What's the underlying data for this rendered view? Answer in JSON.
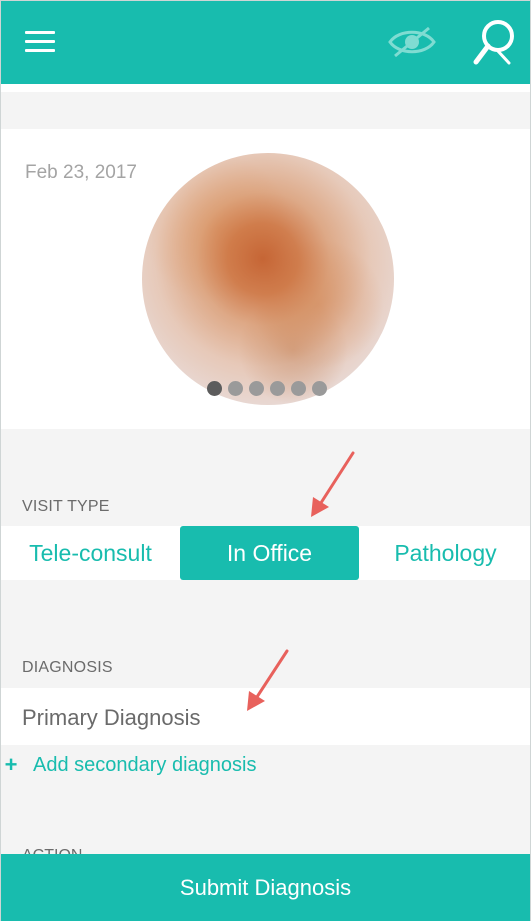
{
  "header": {
    "menu_icon": "hamburger-menu-icon",
    "privacy_icon": "eye-off-icon",
    "search_icon": "magnifier-icon"
  },
  "photo": {
    "date": "Feb 23, 2017",
    "image_icon": "dermoscopy-lesion-image",
    "pages_total": 6,
    "current_page": 1
  },
  "visit_type": {
    "label": "VISIT TYPE",
    "options": [
      "Tele-consult",
      "In Office",
      "Pathology"
    ],
    "selected": "In Office"
  },
  "diagnosis": {
    "label": "DIAGNOSIS",
    "primary": "Primary Diagnosis",
    "add_secondary_symbol": "+",
    "add_secondary_label": "Add secondary diagnosis"
  },
  "action": {
    "label": "ACTION"
  },
  "footer": {
    "submit_label": "Submit Diagnosis"
  },
  "colors": {
    "accent": "#18bcae",
    "annotation_arrow": "#e8615c"
  }
}
